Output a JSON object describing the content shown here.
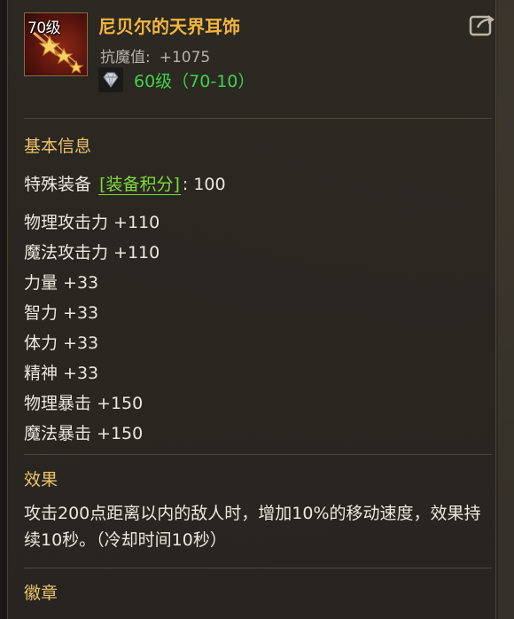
{
  "item": {
    "icon_level_label": "70级",
    "name": "尼贝尔的天界耳饰",
    "resist_label": "抗魔值:",
    "resist_value": "+1075",
    "level_text": "60级（70-10）"
  },
  "basic_info": {
    "title": "基本信息",
    "special_label": "特殊装备",
    "special_tag": "[装备积分]",
    "special_suffix": ": 100",
    "stats": [
      "物理攻击力 +110",
      "魔法攻击力 +110",
      "力量 +33",
      "智力 +33",
      "体力 +33",
      "精神 +33",
      "物理暴击 +150",
      "魔法暴击 +150"
    ]
  },
  "effect": {
    "title": "效果",
    "text": "攻击200点距离以内的敌人时，增加10%的移动速度，效果持续10秒。（冷却时间10秒）"
  },
  "badge": {
    "title": "徽章"
  },
  "colors": {
    "item_name": "#f2b63c",
    "section_title": "#ecc46a",
    "level_green": "#3fd24a",
    "tag_green": "#7ddc3a"
  },
  "icons": {
    "item": "stars-earring-icon",
    "gem": "diamond-gem-icon",
    "share": "share-export-icon"
  }
}
